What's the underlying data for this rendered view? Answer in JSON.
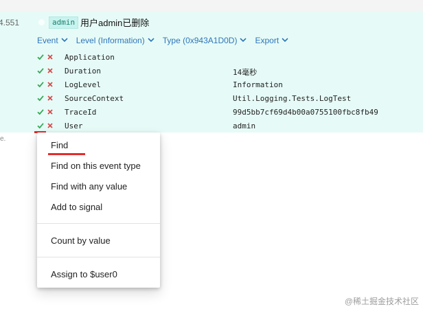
{
  "event": {
    "timestamp": "4.551",
    "tag": "admin",
    "message": "用户admin已删除"
  },
  "actions": [
    {
      "label": "Event",
      "icon": "chevron-down-icon"
    },
    {
      "label": "Level (Information)",
      "icon": "chevron-down-icon"
    },
    {
      "label": "Type (0x943A1D0D)",
      "icon": "chevron-down-icon"
    },
    {
      "label": "Export",
      "icon": "chevron-down-icon"
    }
  ],
  "properties": [
    {
      "name": "Application",
      "value": ""
    },
    {
      "name": "Duration",
      "value": "14毫秒"
    },
    {
      "name": "LogLevel",
      "value": "Information"
    },
    {
      "name": "SourceContext",
      "value": "Util.Logging.Tests.LogTest"
    },
    {
      "name": "TraceId",
      "value": "99d5bb7cf69d4b00a0755100fbc8fb49"
    },
    {
      "name": "User",
      "value": "admin"
    }
  ],
  "menu": {
    "items": [
      "Find",
      "Find on this event type",
      "Find with any value",
      "Add to signal",
      "Count by value",
      "Assign to $user0"
    ]
  },
  "edge_text": "e.",
  "watermark": "@稀土掘金技术社区",
  "colors": {
    "panel_background": "#e6fbf7",
    "tag_background": "#c8f3ee",
    "action_blue": "#2f75bb",
    "check_green": "#3aa85a",
    "close_red": "#d64b4b",
    "annotation_red": "#e52b2b"
  }
}
